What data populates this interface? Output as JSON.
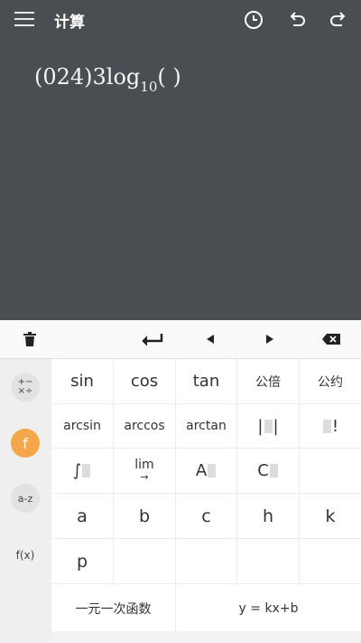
{
  "header": {
    "title": "计算"
  },
  "display": {
    "expr_main": "(024)3log",
    "expr_sub": "10",
    "expr_tail": "(  )"
  },
  "sidebar": {
    "ops_label": "+− ×÷",
    "func_label": "f",
    "alpha_label": "a-z",
    "fx_label": "f(x)"
  },
  "keys": {
    "sin": "sin",
    "cos": "cos",
    "tan": "tan",
    "lcm": "公倍",
    "gcd": "公约",
    "arcsin": "arcsin",
    "arccos": "arccos",
    "arctan": "arctan",
    "abs_bar": "|",
    "fact": "!",
    "integral": "∫",
    "lim": "lim",
    "lim_arrow": "→",
    "perm": "A",
    "comb": "C",
    "a": "a",
    "b": "b",
    "c": "c",
    "h": "h",
    "k": "k",
    "p": "p",
    "linear": "一元一次函数",
    "linear_eq": "y = kx+b"
  }
}
